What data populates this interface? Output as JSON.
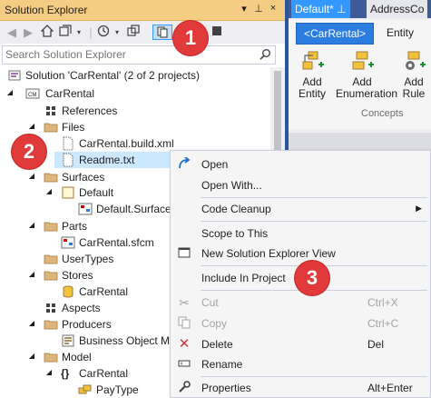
{
  "solution_explorer": {
    "title": "Solution Explorer",
    "title_buttons": [
      "▾",
      "⊥",
      "×"
    ],
    "search_placeholder": "Search Solution Explorer",
    "tree": [
      {
        "label": "Solution 'CarRental' (2 of 2 projects)",
        "icon": "solution-icon",
        "depth": 0,
        "expander": ""
      },
      {
        "label": "CarRental",
        "icon": "codemodeler-project-icon",
        "depth": 0,
        "expander": "expanded"
      },
      {
        "label": "References",
        "icon": "references-icon",
        "depth": 1,
        "expander": ""
      },
      {
        "label": "Files",
        "icon": "folder-icon",
        "depth": 1,
        "expander": "expanded"
      },
      {
        "label": "CarRental.build.xml",
        "icon": "file-icon",
        "depth": 2,
        "expander": ""
      },
      {
        "label": "Readme.txt",
        "icon": "file-icon",
        "depth": 2,
        "expander": "",
        "selected": true
      },
      {
        "label": "Surfaces",
        "icon": "folder-icon",
        "depth": 1,
        "expander": "expanded"
      },
      {
        "label": "Default",
        "icon": "surface-folder-icon",
        "depth": 2,
        "expander": "expanded"
      },
      {
        "label": "Default.Surface.",
        "icon": "surface-icon",
        "depth": 3,
        "expander": ""
      },
      {
        "label": "Parts",
        "icon": "folder-icon",
        "depth": 1,
        "expander": "expanded"
      },
      {
        "label": "CarRental.sfcm",
        "icon": "surface-icon",
        "depth": 2,
        "expander": ""
      },
      {
        "label": "UserTypes",
        "icon": "folder-icon",
        "depth": 1,
        "expander": ""
      },
      {
        "label": "Stores",
        "icon": "folder-icon",
        "depth": 1,
        "expander": "expanded"
      },
      {
        "label": "CarRental",
        "icon": "store-icon",
        "depth": 2,
        "expander": ""
      },
      {
        "label": "Aspects",
        "icon": "aspects-icon",
        "depth": 1,
        "expander": ""
      },
      {
        "label": "Producers",
        "icon": "folder-icon",
        "depth": 1,
        "expander": "expanded"
      },
      {
        "label": "Business Object Mo",
        "icon": "producer-icon",
        "depth": 2,
        "expander": ""
      },
      {
        "label": "Model",
        "icon": "folder-icon",
        "depth": 1,
        "expander": "expanded"
      },
      {
        "label": "CarRental",
        "icon": "namespace-icon",
        "depth": 2,
        "expander": "expanded"
      },
      {
        "label": "PayType",
        "icon": "enumeration-icon",
        "depth": 3,
        "expander": ""
      }
    ]
  },
  "editor": {
    "tabs": [
      {
        "label": "Default*",
        "close": "⊥"
      },
      {
        "label": "AddressCo"
      }
    ],
    "ribbon_tabs": [
      "<CarRental>",
      "Entity"
    ],
    "ribbon_buttons": [
      {
        "label_line1": "Add",
        "label_line2": "Entity"
      },
      {
        "label_line1": "Add",
        "label_line2": "Enumeration"
      },
      {
        "label_line1": "Add",
        "label_line2": "Rule"
      }
    ],
    "group_label": "Concepts"
  },
  "context_menu": {
    "items": [
      {
        "label": "Open",
        "icon": "open-arrow-icon"
      },
      {
        "label": "Open With...",
        "icon": ""
      },
      {
        "separator": true
      },
      {
        "label": "Code Cleanup",
        "icon": "",
        "submenu": true
      },
      {
        "separator": true
      },
      {
        "label": "Scope to This",
        "icon": ""
      },
      {
        "label": "New Solution Explorer View",
        "icon": "new-view-icon"
      },
      {
        "separator": true
      },
      {
        "label": "Include In Project",
        "icon": ""
      },
      {
        "separator": true
      },
      {
        "label": "Cut",
        "icon": "cut-icon",
        "shortcut": "Ctrl+X",
        "disabled": true
      },
      {
        "label": "Copy",
        "icon": "copy-icon",
        "shortcut": "Ctrl+C",
        "disabled": true
      },
      {
        "label": "Delete",
        "icon": "delete-icon",
        "shortcut": "Del"
      },
      {
        "label": "Rename",
        "icon": "rename-icon"
      },
      {
        "separator": true
      },
      {
        "label": "Properties",
        "icon": "properties-icon",
        "shortcut": "Alt+Enter"
      }
    ]
  },
  "callouts": [
    "1",
    "2",
    "3"
  ],
  "colors": {
    "title_bar": "#f5cc84",
    "accent": "#3399ff",
    "selection": "#cce8ff",
    "badge": "#e03a3a",
    "editor_border": "#2b579a"
  }
}
